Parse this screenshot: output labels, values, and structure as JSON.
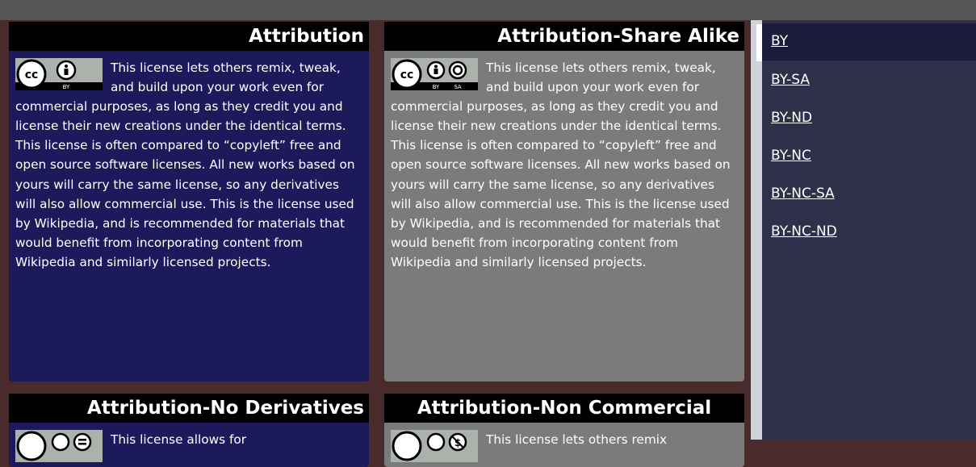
{
  "colors": {
    "background": "#4a2b2b",
    "card_blue": "#1d1a5c",
    "card_gray": "#7b7b7b",
    "sidebar": "#30304a",
    "sidebar_active": "#1b1b3c"
  },
  "cards": [
    {
      "title": "Attribution",
      "badge_icons": [
        "cc-icon",
        "by-icon"
      ],
      "badge_labels": [
        "BY"
      ],
      "description": "This license lets others remix, tweak, and build upon your work even for commercial purposes, as long as they credit you and license their new creations under the identical terms. This license is often compared to “copyleft” free and open source software licenses. All new works based on yours will carry the same license, so any derivatives will also allow commercial use. This is the license used by Wikipedia, and is recommended for materials that would benefit from incorporating content from Wikipedia and similarly licensed projects."
    },
    {
      "title": "Attribution-Share Alike",
      "badge_icons": [
        "cc-icon",
        "by-icon",
        "sa-icon"
      ],
      "badge_labels": [
        "BY",
        "SA"
      ],
      "description": "This license lets others remix, tweak, and build upon your work even for commercial purposes, as long as they credit you and license their new creations under the identical terms. This license is often compared to “copyleft” free and open source software licenses. All new works based on yours will carry the same license, so any derivatives will also allow commercial use. This is the license used by Wikipedia, and is recommended for materials that would benefit from incorporating content from Wikipedia and similarly licensed projects."
    },
    {
      "title": "Attribution-No Derivatives",
      "badge_icons": [
        "cc-icon",
        "by-icon",
        "nd-icon"
      ],
      "description": "This license allows for"
    },
    {
      "title": "Attribution-Non Commercial",
      "badge_icons": [
        "cc-icon",
        "by-icon",
        "nc-icon"
      ],
      "description": "This license lets others remix"
    }
  ],
  "sidebar": {
    "items": [
      {
        "label": "BY",
        "active": true
      },
      {
        "label": "BY-SA"
      },
      {
        "label": "BY-ND"
      },
      {
        "label": "BY-NC"
      },
      {
        "label": "BY-NC-SA"
      },
      {
        "label": "BY-NC-ND"
      }
    ]
  }
}
